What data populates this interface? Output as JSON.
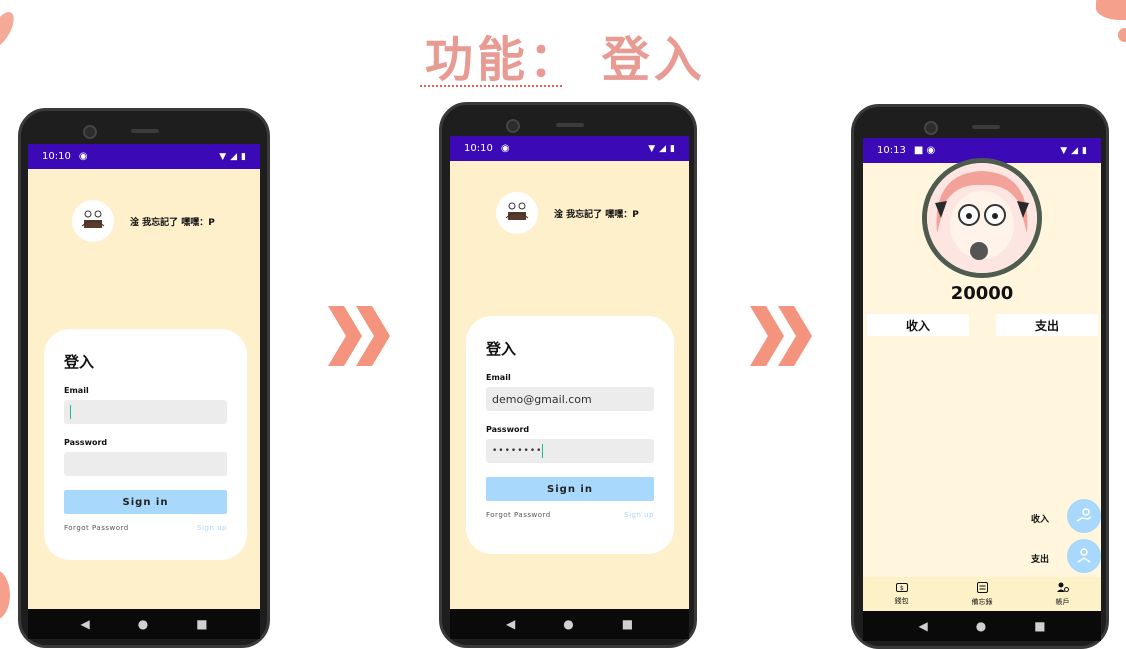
{
  "headline": "功能： 登入",
  "colors": {
    "accent": "#e89b93",
    "status_bar": "#3b09b5",
    "screen_bg": "#fff0cc",
    "button": "#a8d8fb"
  },
  "phone1": {
    "status": {
      "time": "10:10"
    },
    "profile_text": "淦 我忘記了 嘿嘿：P",
    "login": {
      "title": "登入",
      "email_label": "Email",
      "email_value": "",
      "password_label": "Password",
      "password_value": "",
      "sign_in": "Sign in",
      "forgot": "Forgot Password",
      "sign_up": "Sign up"
    }
  },
  "phone2": {
    "status": {
      "time": "10:10"
    },
    "profile_text": "淦 我忘記了 嘿嘿：P",
    "login": {
      "title": "登入",
      "email_label": "Email",
      "email_value": "demo@gmail.com",
      "password_label": "Password",
      "password_value": "••••••••",
      "sign_in": "Sign in",
      "forgot": "Forgot Password",
      "sign_up": "Sign up"
    }
  },
  "phone3": {
    "status": {
      "time": "10:13"
    },
    "balance": "20000",
    "income_tab": "收入",
    "expense_tab": "支出",
    "fab_income_label": "收入",
    "fab_expense_label": "支出",
    "bottom_nav": [
      "錢包",
      "備忘錄",
      "帳戶"
    ]
  },
  "nav_glyphs": {
    "back": "◀",
    "home": "●",
    "recents": "■"
  }
}
